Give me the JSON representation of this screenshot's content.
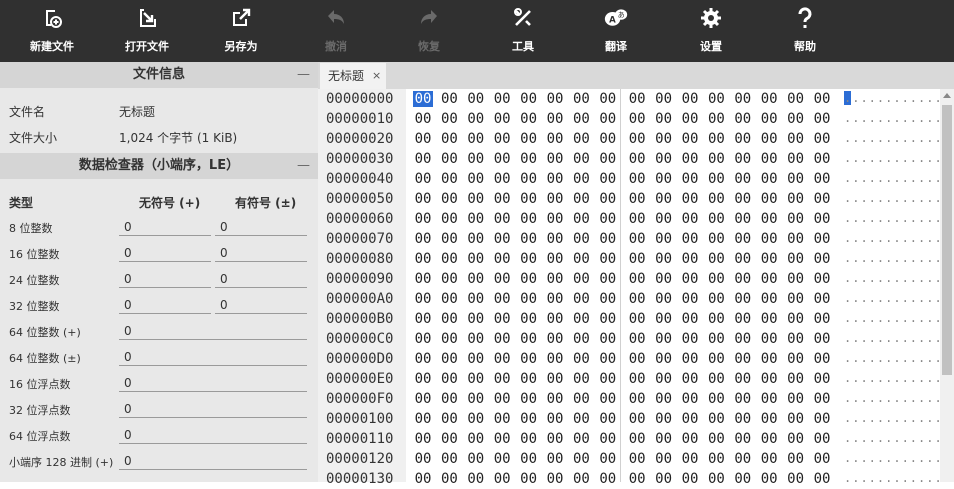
{
  "toolbar": {
    "new_file": "新建文件",
    "open_file": "打开文件",
    "save_as": "另存为",
    "undo": "撤消",
    "redo": "恢复",
    "tools": "工具",
    "translate": "翻译",
    "settings": "设置",
    "help": "帮助"
  },
  "file_info": {
    "title": "文件信息",
    "collapse": "—",
    "name_label": "文件名",
    "name_value": "无标题",
    "size_label": "文件大小",
    "size_value": "1,024 个字节 (1 KiB)"
  },
  "inspector": {
    "title": "数据检查器（小端序，LE）",
    "collapse": "—",
    "col_type": "类型",
    "col_unsigned": "无符号 (+)",
    "col_signed": "有符号 (±)",
    "rows": [
      {
        "type": "8 位整数",
        "unsigned": "0",
        "signed": "0"
      },
      {
        "type": "16 位整数",
        "unsigned": "0",
        "signed": "0"
      },
      {
        "type": "24 位整数",
        "unsigned": "0",
        "signed": "0"
      },
      {
        "type": "32 位整数",
        "unsigned": "0",
        "signed": "0"
      },
      {
        "type": "64 位整数 (+)",
        "value": "0"
      },
      {
        "type": "64 位整数 (±)",
        "value": "0"
      },
      {
        "type": "16 位浮点数",
        "value": "0"
      },
      {
        "type": "32 位浮点数",
        "value": "0"
      },
      {
        "type": "64 位浮点数",
        "value": "0"
      },
      {
        "type": "小端序 128 进制 (+)",
        "value": "0"
      }
    ]
  },
  "tab": {
    "title": "无标题",
    "close": "×"
  },
  "hex": {
    "addresses": [
      "00000000",
      "00000010",
      "00000020",
      "00000030",
      "00000040",
      "00000050",
      "00000060",
      "00000070",
      "00000080",
      "00000090",
      "000000A0",
      "000000B0",
      "000000C0",
      "000000D0",
      "000000E0",
      "000000F0",
      "00000100",
      "00000110",
      "00000120",
      "00000130"
    ],
    "byte": "00",
    "ascii": "................",
    "selected_byte": 0
  }
}
